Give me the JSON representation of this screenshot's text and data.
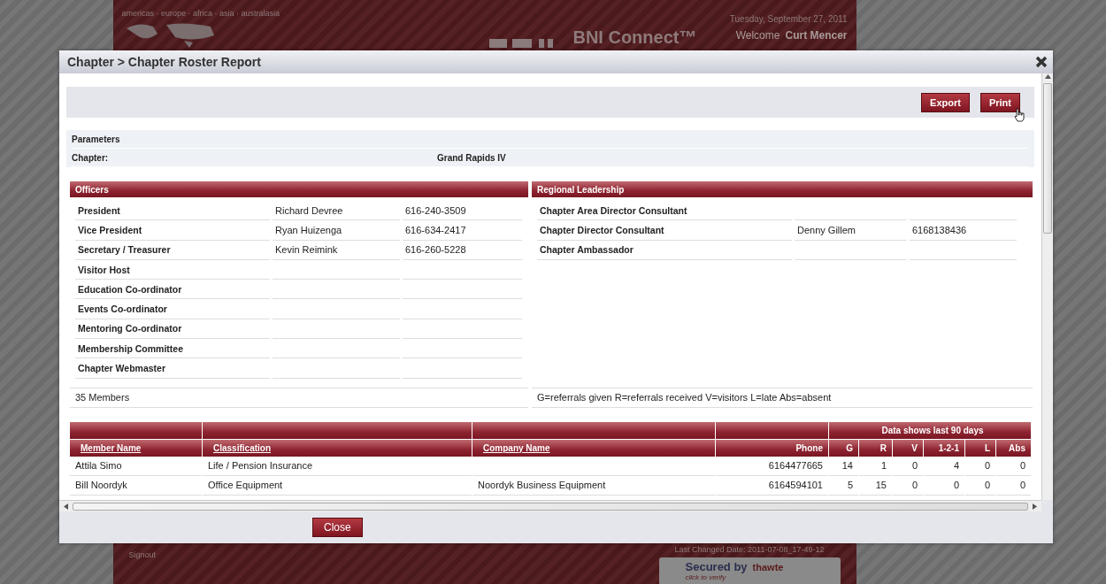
{
  "site": {
    "regions": "americas · europe · africa · asia · australasia",
    "date": "Tuesday, September 27, 2011",
    "welcome_label": "Welcome",
    "welcome_name": "Curt Mencer",
    "brand": "BNI Connect™",
    "signout": "Signout",
    "last_changed": "Last Changed Date: 2011-07-08_17-49-12",
    "seal": {
      "secured_by": "Secured by",
      "brand": "thawte",
      "verify": "click to verify"
    }
  },
  "dialog": {
    "title": "Chapter > Chapter Roster Report",
    "toolbar": [
      "Export",
      "Print"
    ],
    "parameters": {
      "heading": "Parameters",
      "rows": [
        {
          "label": "Chapter:",
          "value": "Grand Rapids IV"
        }
      ]
    },
    "officers": {
      "heading": "Officers",
      "rows": [
        {
          "role": "President",
          "name": "Richard Devree",
          "phone": "616-240-3509"
        },
        {
          "role": "Vice President",
          "name": "Ryan Huizenga",
          "phone": "616-634-2417"
        },
        {
          "role": "Secretary / Treasurer",
          "name": "Kevin Reimink",
          "phone": "616-260-5228"
        },
        {
          "role": "Visitor Host"
        },
        {
          "role": "Education Co-ordinator"
        },
        {
          "role": "Events Co-ordinator"
        },
        {
          "role": "Mentoring Co-ordinator"
        },
        {
          "role": "Membership Committee"
        },
        {
          "role": "Chapter Webmaster"
        }
      ]
    },
    "regional": {
      "heading": "Regional Leadership",
      "rows": [
        {
          "role": "Chapter Area Director Consultant"
        },
        {
          "role": "Chapter Director Consultant",
          "name": "Denny Gillem",
          "phone": "6168138436"
        },
        {
          "role": "Chapter Ambassador"
        }
      ]
    },
    "member_count": "35 Members",
    "legend": "G=referrals given R=referrals received V=visitors L=late Abs=absent",
    "members": {
      "group_header": "Data shows last 90 days",
      "columns": [
        {
          "label": "Member Name",
          "sortable": true
        },
        {
          "label": "Classification",
          "sortable": true
        },
        {
          "label": "Company Name",
          "sortable": true
        },
        {
          "label": "Phone",
          "sortable": false
        },
        {
          "label": "G",
          "sortable": false
        },
        {
          "label": "R",
          "sortable": false
        },
        {
          "label": "V",
          "sortable": false
        },
        {
          "label": "1-2-1",
          "sortable": false
        },
        {
          "label": "L",
          "sortable": false
        },
        {
          "label": "Abs",
          "sortable": false
        }
      ],
      "rows": [
        [
          "Attila Simo",
          "Life / Pension Insurance",
          "",
          "6164477665",
          "14",
          "1",
          "0",
          "4",
          "0",
          "0"
        ],
        [
          "Bill Noordyk",
          "Office Equipment",
          "Noordyk Business Equipment",
          "6164594101",
          "5",
          "15",
          "0",
          "0",
          "0",
          "0"
        ]
      ]
    },
    "close_button": "Close"
  }
}
